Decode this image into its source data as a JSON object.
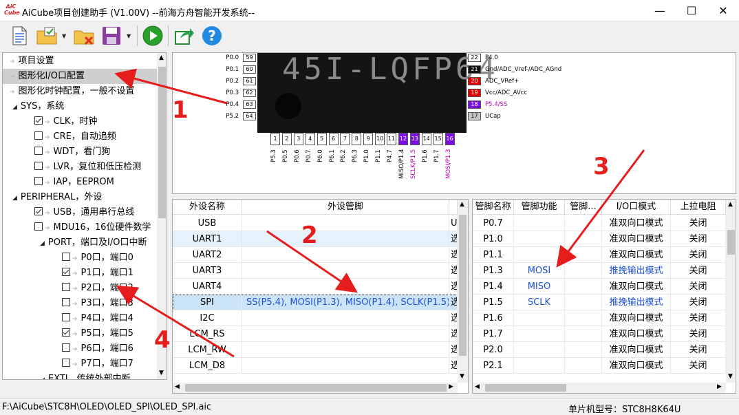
{
  "app": {
    "logo_text": "AiCube",
    "title": "AiCube项目创建助手 (V1.00V) --前海方舟智能开发系统--",
    "controls": [
      "—",
      "☐",
      "✕"
    ]
  },
  "toolbar": {
    "buttons": [
      "new-file-icon",
      "open-folder-icon",
      "close-file-icon",
      "save-icon",
      "run-icon",
      "export-icon",
      "help-icon"
    ]
  },
  "tree": {
    "items": [
      {
        "label": "项目设置",
        "kind": "leaf",
        "level": 0
      },
      {
        "label": "图形化I/O口配置",
        "kind": "leaf",
        "level": 0,
        "selected": true
      },
      {
        "label": "图形化时钟配置，一般不设置",
        "kind": "leaf",
        "level": 0
      },
      {
        "label": "SYS，系统",
        "kind": "group",
        "level": 0
      },
      {
        "label": "CLK，时钟",
        "kind": "check",
        "level": 1,
        "checked": true
      },
      {
        "label": "CRE，自动追频",
        "kind": "check",
        "level": 1,
        "checked": false
      },
      {
        "label": "WDT，看门狗",
        "kind": "check",
        "level": 1,
        "checked": false
      },
      {
        "label": "LVR，复位和低压检测",
        "kind": "check",
        "level": 1,
        "checked": false
      },
      {
        "label": "IAP，EEPROM",
        "kind": "check",
        "level": 1,
        "checked": false
      },
      {
        "label": "PERIPHERAL，外设",
        "kind": "group",
        "level": 0
      },
      {
        "label": "USB，通用串行总线",
        "kind": "check",
        "level": 1,
        "checked": true
      },
      {
        "label": "MDU16，16位硬件数学",
        "kind": "check",
        "level": 1,
        "checked": false
      },
      {
        "label": "PORT，端口及I/O口中断",
        "kind": "group",
        "level": 1
      },
      {
        "label": "P0口，端口0",
        "kind": "check",
        "level": 2,
        "checked": false
      },
      {
        "label": "P1口，端口1",
        "kind": "check",
        "level": 2,
        "checked": true
      },
      {
        "label": "P2口，端口2",
        "kind": "check",
        "level": 2,
        "checked": false
      },
      {
        "label": "P3口，端口3",
        "kind": "check",
        "level": 2,
        "checked": false
      },
      {
        "label": "P4口，端口4",
        "kind": "check",
        "level": 2,
        "checked": false
      },
      {
        "label": "P5口，端口5",
        "kind": "check",
        "level": 2,
        "checked": true
      },
      {
        "label": "P6口，端口6",
        "kind": "check",
        "level": 2,
        "checked": false
      },
      {
        "label": "P7口，端口7",
        "kind": "check",
        "level": 2,
        "checked": false
      },
      {
        "label": "EXTI，传统外部中断",
        "kind": "group",
        "level": 1
      }
    ]
  },
  "chip": {
    "marking": "45I-LQFP64",
    "left_pins": [
      {
        "name": "P0.0",
        "num": "59"
      },
      {
        "name": "P0.1",
        "num": "60"
      },
      {
        "name": "P0.2",
        "num": "61"
      },
      {
        "name": "P0.3",
        "num": "62"
      },
      {
        "name": "P0.4",
        "num": "63"
      },
      {
        "name": "P5.2",
        "num": "64"
      }
    ],
    "right_pins": [
      {
        "name": "P4.0",
        "num": "22",
        "color": "#fff",
        "text": "#000",
        "label": "#000"
      },
      {
        "name": "Gnd/ADC_Vref-/ADC_AGnd",
        "num": "21",
        "color": "#111",
        "text": "#fff",
        "label": "#000"
      },
      {
        "name": "ADC_VRef+",
        "num": "20",
        "color": "#e00000",
        "text": "#fff",
        "label": "#000"
      },
      {
        "name": "Vcc/ADC_AVcc",
        "num": "19",
        "color": "#e00000",
        "text": "#fff",
        "label": "#000"
      },
      {
        "name": "P5.4/SS",
        "num": "18",
        "color": "#7a10e0",
        "text": "#fff",
        "label": "#c000c0"
      },
      {
        "name": "UCap",
        "num": "17",
        "color": "#c8c8c8",
        "text": "#000",
        "label": "#000"
      }
    ],
    "bottom_pins": [
      {
        "num": "1",
        "name": "P5.3",
        "color": "#fff",
        "text": "#000",
        "label": "#000"
      },
      {
        "num": "2",
        "name": "P0.5",
        "color": "#fff",
        "text": "#000",
        "label": "#000"
      },
      {
        "num": "3",
        "name": "P0.6",
        "color": "#fff",
        "text": "#000",
        "label": "#000"
      },
      {
        "num": "4",
        "name": "P0.7",
        "color": "#fff",
        "text": "#000",
        "label": "#000"
      },
      {
        "num": "5",
        "name": "P6.0",
        "color": "#fff",
        "text": "#000",
        "label": "#000"
      },
      {
        "num": "6",
        "name": "P6.1",
        "color": "#fff",
        "text": "#000",
        "label": "#000"
      },
      {
        "num": "7",
        "name": "P6.2",
        "color": "#fff",
        "text": "#000",
        "label": "#000"
      },
      {
        "num": "8",
        "name": "P6.3",
        "color": "#fff",
        "text": "#000",
        "label": "#000"
      },
      {
        "num": "9",
        "name": "P1.0",
        "color": "#fff",
        "text": "#000",
        "label": "#000"
      },
      {
        "num": "10",
        "name": "P1.1",
        "color": "#fff",
        "text": "#000",
        "label": "#000"
      },
      {
        "num": "11",
        "name": "P4.7",
        "color": "#fff",
        "text": "#000",
        "label": "#000"
      },
      {
        "num": "12",
        "name": "MISO/P1.4",
        "color": "#7a10e0",
        "text": "#fff",
        "label": "#000"
      },
      {
        "num": "13",
        "name": "SCLK/P1.5",
        "color": "#7a10e0",
        "text": "#fff",
        "label": "#c000c0"
      },
      {
        "num": "14",
        "name": "P1.6",
        "color": "#fff",
        "text": "#000",
        "label": "#000"
      },
      {
        "num": "15",
        "name": "P1.7",
        "color": "#fff",
        "text": "#000",
        "label": "#000"
      },
      {
        "num": "16",
        "name": "MOSI/P1.3",
        "color": "#7a10e0",
        "text": "#fff",
        "label": "#c000c0"
      }
    ]
  },
  "peripheral_table": {
    "headers": [
      "外设名称",
      "外设管脚",
      ""
    ],
    "rows": [
      {
        "name": "USB",
        "pins": "",
        "tail": "U"
      },
      {
        "name": "UART1",
        "pins": "",
        "tail": "选"
      },
      {
        "name": "UART2",
        "pins": "",
        "tail": "选"
      },
      {
        "name": "UART3",
        "pins": "",
        "tail": "选"
      },
      {
        "name": "UART4",
        "pins": "",
        "tail": "选"
      },
      {
        "name": "SPI",
        "pins": "SS(P5.4), MOSI(P1.3), MISO(P1.4), SCLK(P1.5)",
        "tail": "选"
      },
      {
        "name": "I2C",
        "pins": "",
        "tail": "选"
      },
      {
        "name": "LCM_RS",
        "pins": "",
        "tail": "选"
      },
      {
        "name": "LCM_RW",
        "pins": "",
        "tail": "选"
      },
      {
        "name": "LCM_D8",
        "pins": "",
        "tail": "选"
      }
    ]
  },
  "pin_table": {
    "headers": [
      "管脚名称",
      "管脚功能",
      "管脚...",
      "I/O口模式",
      "上拉电阻"
    ],
    "rows": [
      {
        "pin": "P0.7",
        "func": "",
        "mode": "准双向口模式",
        "pull": "关闭"
      },
      {
        "pin": "P1.0",
        "func": "",
        "mode": "准双向口模式",
        "pull": "关闭"
      },
      {
        "pin": "P1.1",
        "func": "",
        "mode": "准双向口模式",
        "pull": "关闭"
      },
      {
        "pin": "P1.3",
        "func": "MOSI",
        "mode": "推挽输出模式",
        "pull": "关闭"
      },
      {
        "pin": "P1.4",
        "func": "MISO",
        "mode": "准双向口模式",
        "pull": "关闭"
      },
      {
        "pin": "P1.5",
        "func": "SCLK",
        "mode": "推挽输出模式",
        "pull": "关闭"
      },
      {
        "pin": "P1.6",
        "func": "",
        "mode": "准双向口模式",
        "pull": "关闭"
      },
      {
        "pin": "P1.7",
        "func": "",
        "mode": "准双向口模式",
        "pull": "关闭"
      },
      {
        "pin": "P2.0",
        "func": "",
        "mode": "准双向口模式",
        "pull": "关闭"
      },
      {
        "pin": "P2.1",
        "func": "",
        "mode": "准双向口模式",
        "pull": "关闭"
      }
    ]
  },
  "annotations": [
    "1",
    "2",
    "3",
    "4"
  ],
  "status": {
    "path": "F:\\AiCube\\STC8H\\OLED\\OLED_SPI\\OLED_SPI.aic",
    "mcu": "单片机型号：STC8H8K64U"
  }
}
